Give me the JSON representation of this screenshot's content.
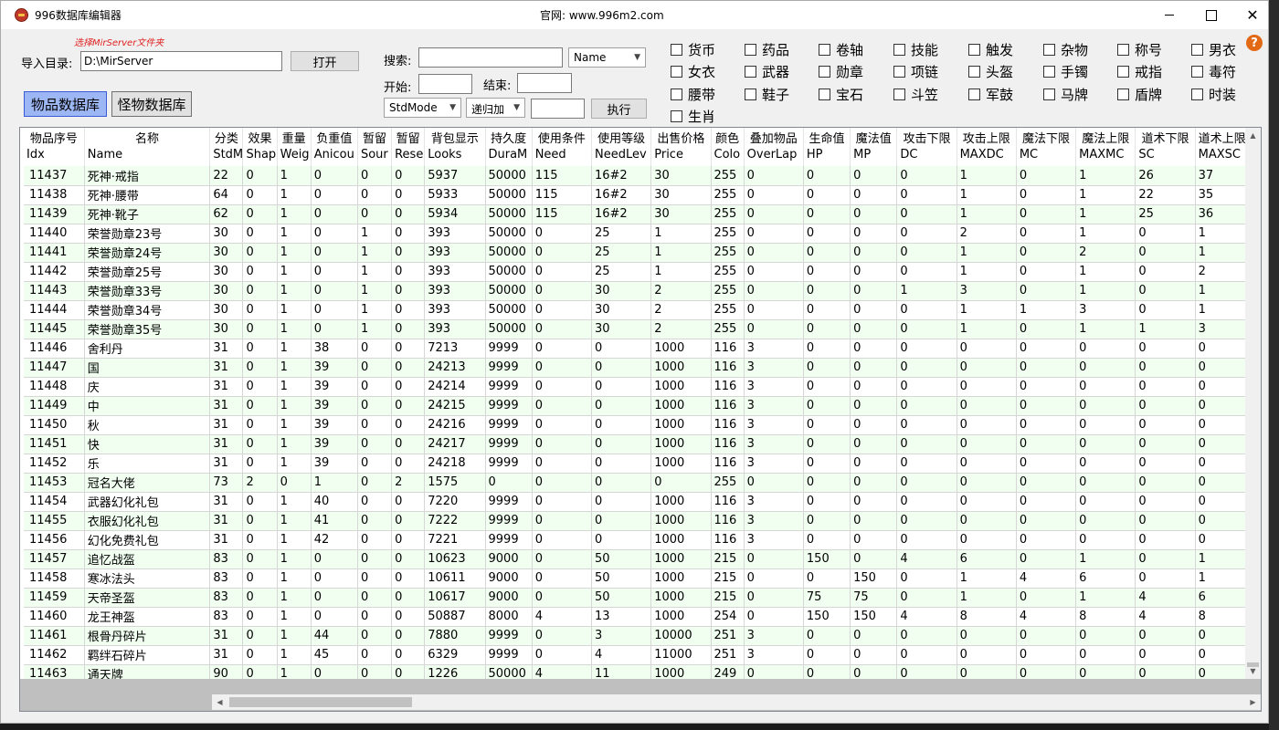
{
  "window": {
    "title": "996数据库编辑器",
    "site": "官网: www.996m2.com"
  },
  "top": {
    "hint": "选择MirServer文件夹",
    "import_label": "导入目录:",
    "import_value": "D:\\MirServer",
    "open_button": "打开",
    "search_label": "搜索:",
    "search_value": "",
    "search_field_select": "Name",
    "start_label": "开始:",
    "end_label": "结束:",
    "mode_select": "StdMode",
    "recur_select": "递归加",
    "exec_value": "",
    "exec_button": "执行",
    "tab_items": "物品数据库",
    "tab_monsters": "怪物数据库"
  },
  "categories": [
    {
      "label": "货币",
      "checked": false
    },
    {
      "label": "药品",
      "checked": false
    },
    {
      "label": "卷轴",
      "checked": false
    },
    {
      "label": "技能",
      "checked": false
    },
    {
      "label": "触发",
      "checked": false
    },
    {
      "label": "杂物",
      "checked": false
    },
    {
      "label": "称号",
      "checked": false
    },
    {
      "label": "男衣",
      "checked": false
    },
    {
      "label": "女衣",
      "checked": false
    },
    {
      "label": "武器",
      "checked": false
    },
    {
      "label": "勋章",
      "checked": false
    },
    {
      "label": "项链",
      "checked": false
    },
    {
      "label": "头盔",
      "checked": false
    },
    {
      "label": "手镯",
      "checked": false
    },
    {
      "label": "戒指",
      "checked": false
    },
    {
      "label": "毒符",
      "checked": false
    },
    {
      "label": "腰带",
      "checked": false
    },
    {
      "label": "鞋子",
      "checked": false
    },
    {
      "label": "宝石",
      "checked": false
    },
    {
      "label": "斗笠",
      "checked": false
    },
    {
      "label": "军鼓",
      "checked": false
    },
    {
      "label": "马牌",
      "checked": false
    },
    {
      "label": "盾牌",
      "checked": false
    },
    {
      "label": "时装",
      "checked": false
    },
    {
      "label": "生肖",
      "checked": false
    }
  ],
  "table": {
    "columns": [
      {
        "cn": "物品序号",
        "en": "Idx"
      },
      {
        "cn": "名称",
        "en": "Name"
      },
      {
        "cn": "分类",
        "en": "StdM"
      },
      {
        "cn": "效果",
        "en": "Shap"
      },
      {
        "cn": "重量",
        "en": "Weig"
      },
      {
        "cn": "负重值",
        "en": "Anicou"
      },
      {
        "cn": "暂留",
        "en": "Sour"
      },
      {
        "cn": "暂留",
        "en": "Rese"
      },
      {
        "cn": "背包显示",
        "en": "Looks"
      },
      {
        "cn": "持久度",
        "en": "DuraM"
      },
      {
        "cn": "使用条件",
        "en": "Need"
      },
      {
        "cn": "使用等级",
        "en": "NeedLev"
      },
      {
        "cn": "出售价格",
        "en": "Price"
      },
      {
        "cn": "颜色",
        "en": "Colo"
      },
      {
        "cn": "叠加物品",
        "en": "OverLap"
      },
      {
        "cn": "生命值",
        "en": "HP"
      },
      {
        "cn": "魔法值",
        "en": "MP"
      },
      {
        "cn": "攻击下限",
        "en": "DC"
      },
      {
        "cn": "攻击上限",
        "en": "MAXDC"
      },
      {
        "cn": "魔法下限",
        "en": "MC"
      },
      {
        "cn": "魔法上限",
        "en": "MAXMC"
      },
      {
        "cn": "道术下限",
        "en": "SC"
      },
      {
        "cn": "道术上限",
        "en": "MAXSC"
      }
    ],
    "rows": [
      [
        "11437",
        "死神·戒指",
        "22",
        "0",
        "1",
        "0",
        "0",
        "0",
        "5937",
        "50000",
        "115",
        "16#2",
        "30",
        "255",
        "0",
        "0",
        "0",
        "0",
        "1",
        "0",
        "1",
        "26",
        "37"
      ],
      [
        "11438",
        "死神·腰带",
        "64",
        "0",
        "1",
        "0",
        "0",
        "0",
        "5933",
        "50000",
        "115",
        "16#2",
        "30",
        "255",
        "0",
        "0",
        "0",
        "0",
        "1",
        "0",
        "1",
        "22",
        "35"
      ],
      [
        "11439",
        "死神·靴子",
        "62",
        "0",
        "1",
        "0",
        "0",
        "0",
        "5934",
        "50000",
        "115",
        "16#2",
        "30",
        "255",
        "0",
        "0",
        "0",
        "0",
        "1",
        "0",
        "1",
        "25",
        "36"
      ],
      [
        "11440",
        "荣誉勋章23号",
        "30",
        "0",
        "1",
        "0",
        "1",
        "0",
        "393",
        "50000",
        "0",
        "25",
        "1",
        "255",
        "0",
        "0",
        "0",
        "0",
        "2",
        "0",
        "1",
        "0",
        "1"
      ],
      [
        "11441",
        "荣誉勋章24号",
        "30",
        "0",
        "1",
        "0",
        "1",
        "0",
        "393",
        "50000",
        "0",
        "25",
        "1",
        "255",
        "0",
        "0",
        "0",
        "0",
        "1",
        "0",
        "2",
        "0",
        "1"
      ],
      [
        "11442",
        "荣誉勋章25号",
        "30",
        "0",
        "1",
        "0",
        "1",
        "0",
        "393",
        "50000",
        "0",
        "25",
        "1",
        "255",
        "0",
        "0",
        "0",
        "0",
        "1",
        "0",
        "1",
        "0",
        "2"
      ],
      [
        "11443",
        "荣誉勋章33号",
        "30",
        "0",
        "1",
        "0",
        "1",
        "0",
        "393",
        "50000",
        "0",
        "30",
        "2",
        "255",
        "0",
        "0",
        "0",
        "1",
        "3",
        "0",
        "1",
        "0",
        "1"
      ],
      [
        "11444",
        "荣誉勋章34号",
        "30",
        "0",
        "1",
        "0",
        "1",
        "0",
        "393",
        "50000",
        "0",
        "30",
        "2",
        "255",
        "0",
        "0",
        "0",
        "0",
        "1",
        "1",
        "3",
        "0",
        "1"
      ],
      [
        "11445",
        "荣誉勋章35号",
        "30",
        "0",
        "1",
        "0",
        "1",
        "0",
        "393",
        "50000",
        "0",
        "30",
        "2",
        "255",
        "0",
        "0",
        "0",
        "0",
        "1",
        "0",
        "1",
        "1",
        "3"
      ],
      [
        "11446",
        "舍利丹",
        "31",
        "0",
        "1",
        "38",
        "0",
        "0",
        "7213",
        "9999",
        "0",
        "0",
        "1000",
        "116",
        "3",
        "0",
        "0",
        "0",
        "0",
        "0",
        "0",
        "0",
        "0"
      ],
      [
        "11447",
        "国",
        "31",
        "0",
        "1",
        "39",
        "0",
        "0",
        "24213",
        "9999",
        "0",
        "0",
        "1000",
        "116",
        "3",
        "0",
        "0",
        "0",
        "0",
        "0",
        "0",
        "0",
        "0"
      ],
      [
        "11448",
        "庆",
        "31",
        "0",
        "1",
        "39",
        "0",
        "0",
        "24214",
        "9999",
        "0",
        "0",
        "1000",
        "116",
        "3",
        "0",
        "0",
        "0",
        "0",
        "0",
        "0",
        "0",
        "0"
      ],
      [
        "11449",
        "中",
        "31",
        "0",
        "1",
        "39",
        "0",
        "0",
        "24215",
        "9999",
        "0",
        "0",
        "1000",
        "116",
        "3",
        "0",
        "0",
        "0",
        "0",
        "0",
        "0",
        "0",
        "0"
      ],
      [
        "11450",
        "秋",
        "31",
        "0",
        "1",
        "39",
        "0",
        "0",
        "24216",
        "9999",
        "0",
        "0",
        "1000",
        "116",
        "3",
        "0",
        "0",
        "0",
        "0",
        "0",
        "0",
        "0",
        "0"
      ],
      [
        "11451",
        "快",
        "31",
        "0",
        "1",
        "39",
        "0",
        "0",
        "24217",
        "9999",
        "0",
        "0",
        "1000",
        "116",
        "3",
        "0",
        "0",
        "0",
        "0",
        "0",
        "0",
        "0",
        "0"
      ],
      [
        "11452",
        "乐",
        "31",
        "0",
        "1",
        "39",
        "0",
        "0",
        "24218",
        "9999",
        "0",
        "0",
        "1000",
        "116",
        "3",
        "0",
        "0",
        "0",
        "0",
        "0",
        "0",
        "0",
        "0"
      ],
      [
        "11453",
        "冠名大佬",
        "73",
        "2",
        "0",
        "1",
        "0",
        "2",
        "1575",
        "0",
        "0",
        "0",
        "0",
        "255",
        "0",
        "0",
        "0",
        "0",
        "0",
        "0",
        "0",
        "0",
        "0"
      ],
      [
        "11454",
        "武器幻化礼包",
        "31",
        "0",
        "1",
        "40",
        "0",
        "0",
        "7220",
        "9999",
        "0",
        "0",
        "1000",
        "116",
        "3",
        "0",
        "0",
        "0",
        "0",
        "0",
        "0",
        "0",
        "0"
      ],
      [
        "11455",
        "衣服幻化礼包",
        "31",
        "0",
        "1",
        "41",
        "0",
        "0",
        "7222",
        "9999",
        "0",
        "0",
        "1000",
        "116",
        "3",
        "0",
        "0",
        "0",
        "0",
        "0",
        "0",
        "0",
        "0"
      ],
      [
        "11456",
        "幻化免费礼包",
        "31",
        "0",
        "1",
        "42",
        "0",
        "0",
        "7221",
        "9999",
        "0",
        "0",
        "1000",
        "116",
        "3",
        "0",
        "0",
        "0",
        "0",
        "0",
        "0",
        "0",
        "0"
      ],
      [
        "11457",
        "追忆战盔",
        "83",
        "0",
        "1",
        "0",
        "0",
        "0",
        "10623",
        "9000",
        "0",
        "50",
        "1000",
        "215",
        "0",
        "150",
        "0",
        "4",
        "6",
        "0",
        "1",
        "0",
        "1"
      ],
      [
        "11458",
        "寒冰法头",
        "83",
        "0",
        "1",
        "0",
        "0",
        "0",
        "10611",
        "9000",
        "0",
        "50",
        "1000",
        "215",
        "0",
        "0",
        "150",
        "0",
        "1",
        "4",
        "6",
        "0",
        "1"
      ],
      [
        "11459",
        "天帝圣盔",
        "83",
        "0",
        "1",
        "0",
        "0",
        "0",
        "10617",
        "9000",
        "0",
        "50",
        "1000",
        "215",
        "0",
        "75",
        "75",
        "0",
        "1",
        "0",
        "1",
        "4",
        "6"
      ],
      [
        "11460",
        "龙王神盔",
        "83",
        "0",
        "1",
        "0",
        "0",
        "0",
        "50887",
        "8000",
        "4",
        "13",
        "1000",
        "254",
        "0",
        "150",
        "150",
        "4",
        "8",
        "4",
        "8",
        "4",
        "8"
      ],
      [
        "11461",
        "根骨丹碎片",
        "31",
        "0",
        "1",
        "44",
        "0",
        "0",
        "7880",
        "9999",
        "0",
        "3",
        "10000",
        "251",
        "3",
        "0",
        "0",
        "0",
        "0",
        "0",
        "0",
        "0",
        "0"
      ],
      [
        "11462",
        "羁绊石碎片",
        "31",
        "0",
        "1",
        "45",
        "0",
        "0",
        "6329",
        "9999",
        "0",
        "4",
        "11000",
        "251",
        "3",
        "0",
        "0",
        "0",
        "0",
        "0",
        "0",
        "0",
        "0"
      ],
      [
        "11463",
        "通天牌",
        "90",
        "0",
        "1",
        "0",
        "0",
        "0",
        "1226",
        "50000",
        "4",
        "11",
        "1000",
        "249",
        "0",
        "0",
        "0",
        "0",
        "0",
        "0",
        "0",
        "0",
        "0"
      ]
    ]
  }
}
